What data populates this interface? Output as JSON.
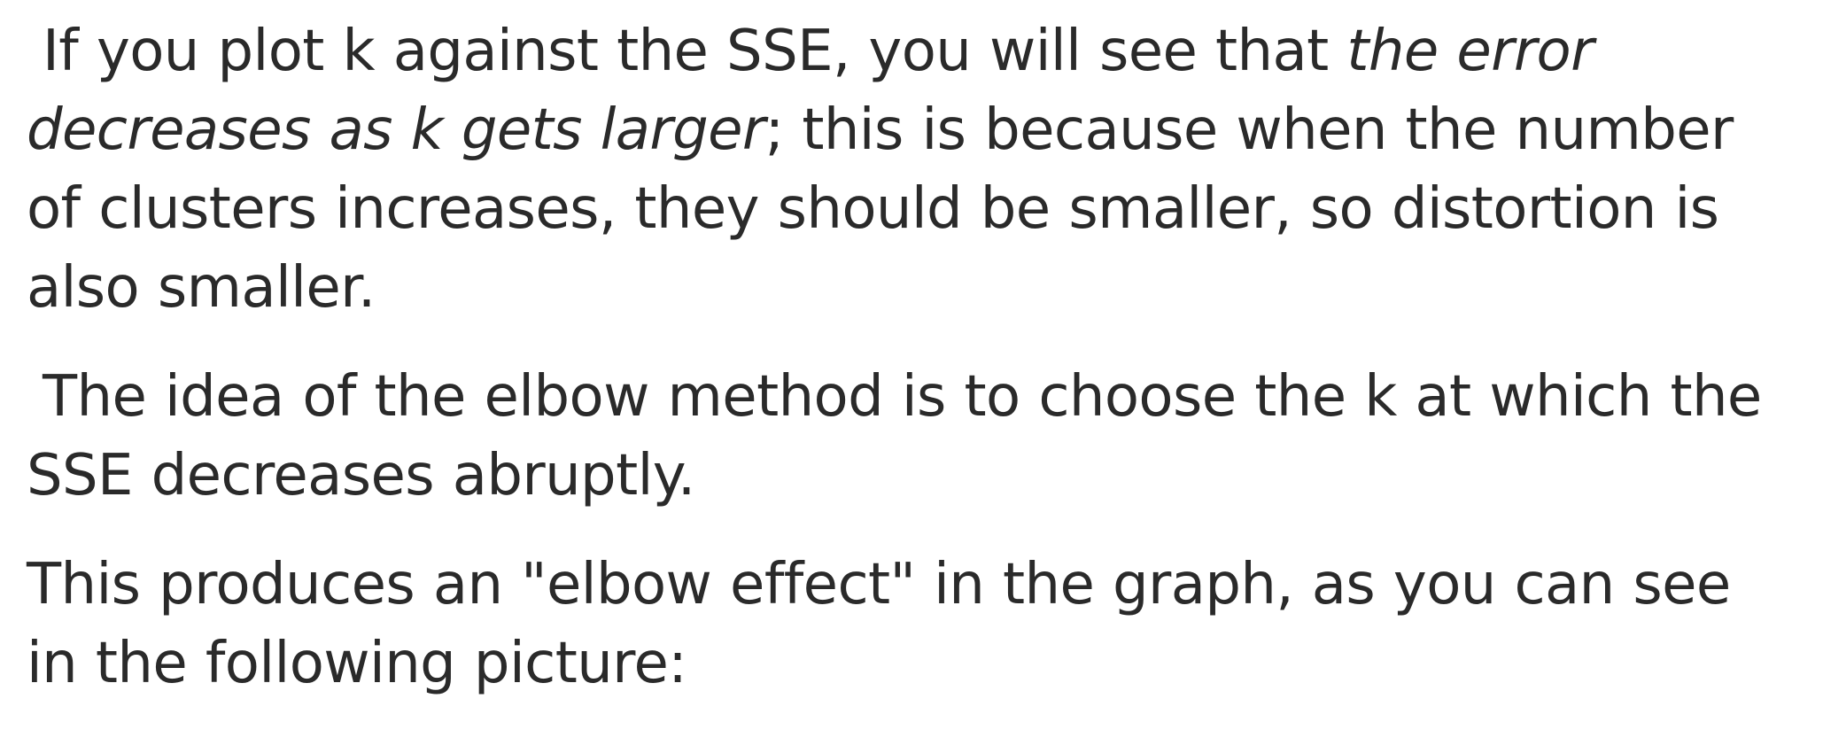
{
  "paragraphs": [
    {
      "lines": [
        {
          "plain_a": "If you plot k against the SSE, you will see that ",
          "italic_a": "the error"
        },
        {
          "italic_a": "decreases as k gets larger",
          "plain_a": "; this is because when the number"
        },
        {
          "plain_a": "of clusters increases, they should be smaller, so distortion is"
        },
        {
          "plain_a": "also smaller."
        }
      ]
    },
    {
      "lines": [
        {
          "plain_a": "The idea of the elbow method is to choose the k at which the"
        },
        {
          "plain_a": "SSE decreases abruptly."
        }
      ]
    },
    {
      "lines": [
        {
          "plain_a": "This produces an \"elbow effect\" in the graph, as you can see"
        },
        {
          "plain_a": "in the following picture:"
        }
      ]
    }
  ]
}
